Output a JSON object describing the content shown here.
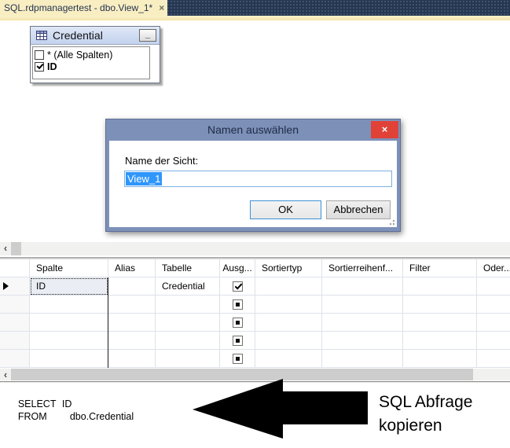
{
  "tab": {
    "title": "SQL.rdpmanagertest - dbo.View_1*"
  },
  "icons": {
    "close": "×",
    "minimize": "_",
    "scroll_left": "‹"
  },
  "credential_window": {
    "title": "Credential",
    "items": [
      {
        "label": "* (Alle Spalten)",
        "state": "unchecked"
      },
      {
        "label": "ID",
        "state": "checked"
      }
    ]
  },
  "dialog": {
    "title": "Namen auswählen",
    "field_label": "Name der Sicht:",
    "field_value": "View_1",
    "ok_label": "OK",
    "cancel_label": "Abbrechen"
  },
  "grid": {
    "columns": [
      "Spalte",
      "Alias",
      "Tabelle",
      "Ausg...",
      "Sortiertyp",
      "Sortierreihenf...",
      "Filter",
      "Oder..."
    ],
    "rows": [
      {
        "spalte": "ID",
        "alias": "",
        "tabelle": "Credential",
        "ausgabe": "checked"
      },
      {
        "spalte": "",
        "alias": "",
        "tabelle": "",
        "ausgabe": "dot"
      },
      {
        "spalte": "",
        "alias": "",
        "tabelle": "",
        "ausgabe": "dot"
      },
      {
        "spalte": "",
        "alias": "",
        "tabelle": "",
        "ausgabe": "dot"
      },
      {
        "spalte": "",
        "alias": "",
        "tabelle": "",
        "ausgabe": "dot"
      }
    ]
  },
  "sql": {
    "lines": [
      {
        "keyword": "SELECT",
        "value": "ID"
      },
      {
        "keyword": "FROM",
        "value": "dbo.Credential"
      }
    ]
  },
  "annotation": {
    "text": "SQL Abfrage kopieren"
  },
  "colors": {
    "tabbar_bg": "#263751",
    "tab_bg": "#f8eec2",
    "dialog_frame": "#7d90b8",
    "dialog_close": "#e04238",
    "selection": "#2f96fb",
    "window_titlebar": "#cdd9f0"
  }
}
